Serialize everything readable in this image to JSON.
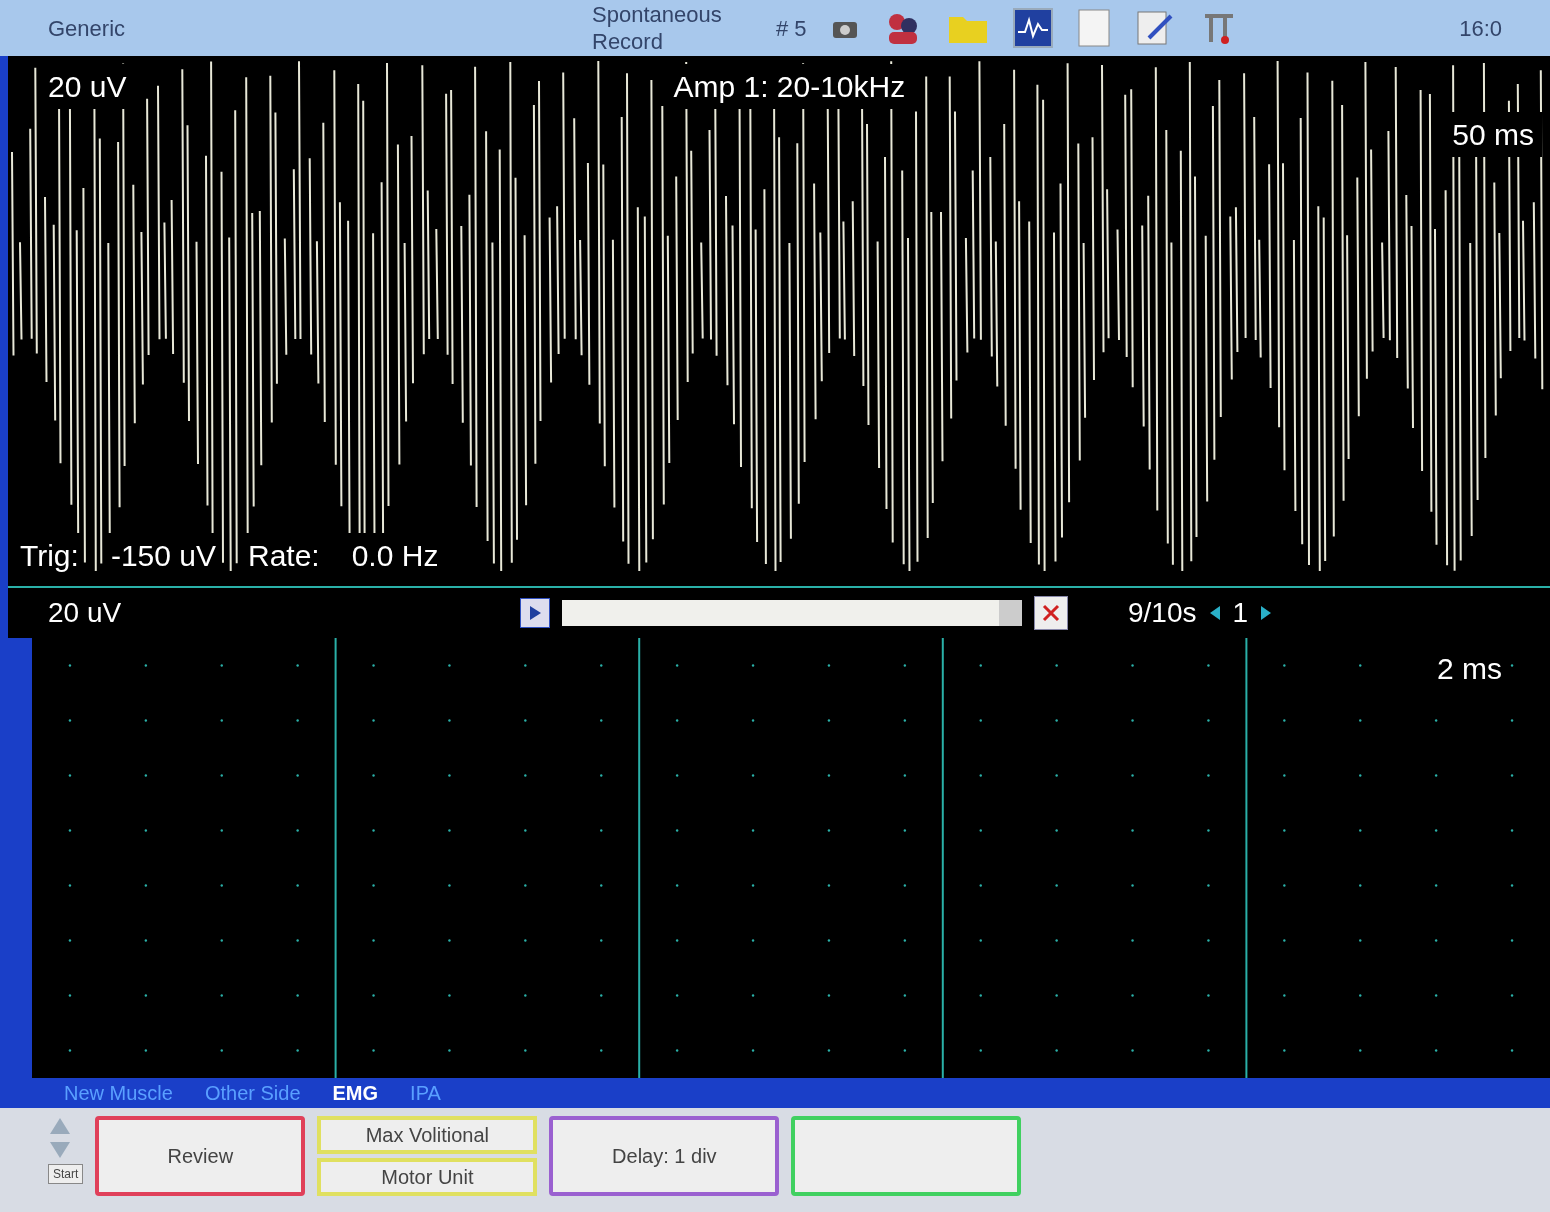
{
  "toolbar": {
    "mode": "Generic",
    "test": [
      "Spontaneous",
      "Record"
    ],
    "count": "# 5",
    "clock": "16:0"
  },
  "upper_trace": {
    "sensitivity": "20 uV",
    "amplifier": "Amp 1: 20-10kHz",
    "sweep": "50 ms",
    "trigger_label": "Trig:",
    "trigger_value": "-150 uV",
    "rate_label": "Rate:",
    "rate_value": "0.0 Hz"
  },
  "playback": {
    "level": 0.95,
    "position": "9/10s",
    "page": "1"
  },
  "lower_trace": {
    "sensitivity": "20 uV",
    "sweep": "2 ms"
  },
  "tabs": [
    {
      "label": "New Muscle",
      "selected": false
    },
    {
      "label": "Other Side",
      "selected": false
    },
    {
      "label": "EMG",
      "selected": true
    },
    {
      "label": "IPA",
      "selected": false
    }
  ],
  "buttons": [
    {
      "label": "Review",
      "color": "#e0405a"
    },
    {
      "label": "Max Volitional",
      "color": "#e0e060"
    },
    {
      "label": "Motor Unit",
      "color": "#e0e060"
    },
    {
      "label": "Delay: 1 div",
      "color": "#9a60d0"
    }
  ],
  "taskbar": {
    "start": "Start"
  }
}
